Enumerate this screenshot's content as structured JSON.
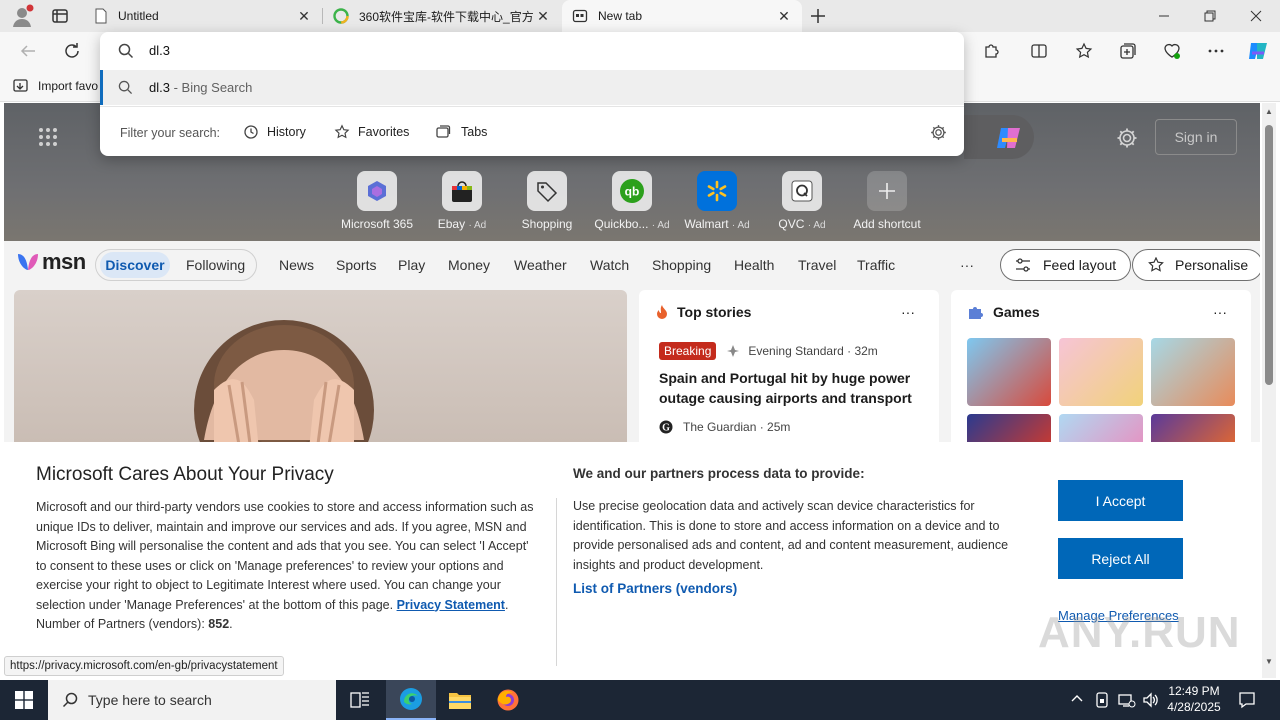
{
  "tabs": [
    {
      "title": "Untitled",
      "icon": "page-icon"
    },
    {
      "title": "360软件宝库-软件下载中心_官方",
      "icon": "360-icon"
    },
    {
      "title": "New tab",
      "icon": "newtab-icon"
    }
  ],
  "address": {
    "value": "dl.3"
  },
  "suggestion": {
    "text": "dl.3",
    "suffix": " - Bing Search"
  },
  "filter": {
    "label": "Filter your search:",
    "history": "History",
    "favorites": "Favorites",
    "tabs": "Tabs"
  },
  "favbar": {
    "import": "Import favo"
  },
  "shortcuts": [
    {
      "label": "Microsoft 365",
      "ad": ""
    },
    {
      "label": "Ebay",
      "ad": "· Ad"
    },
    {
      "label": "Shopping",
      "ad": ""
    },
    {
      "label": "Quickbo...",
      "ad": "· Ad"
    },
    {
      "label": "Walmart",
      "ad": "· Ad"
    },
    {
      "label": "QVC",
      "ad": "· Ad"
    },
    {
      "label": "Add shortcut",
      "ad": ""
    }
  ],
  "signin": "Sign in",
  "msn": {
    "logo": "msn",
    "discover": "Discover",
    "following": "Following",
    "nav": [
      "News",
      "Sports",
      "Play",
      "Money",
      "Weather",
      "Watch",
      "Shopping",
      "Health",
      "Travel",
      "Traffic"
    ],
    "more": "···",
    "feed_layout": "Feed layout",
    "personalise": "Personalise"
  },
  "topstories": {
    "title": "Top stories",
    "more": "···",
    "badge": "Breaking",
    "source1": "Evening Standard · 32m",
    "headline": "Spain and Portugal hit by huge power outage causing airports and transport t...",
    "source2": "The Guardian · 25m"
  },
  "games": {
    "title": "Games",
    "more": "···"
  },
  "consent": {
    "title": "Microsoft Cares About Your Privacy",
    "body": "Microsoft and our third-party vendors use cookies to store and access information such as unique IDs to deliver, maintain and improve our services and ads. If you agree, MSN and Microsoft Bing will personalise the content and ads that you see. You can select 'I Accept' to consent to these uses or click on 'Manage preferences' to review your options and exercise your right to object to Legitimate Interest where used.  You can change your selection under 'Manage Preferences' at the bottom of this page.",
    "privacy_link": "Privacy Statement",
    "partners_label": "Number of Partners (vendors):",
    "partners_count": "852",
    "right_title": "We and our partners process data to provide:",
    "right_body": "Use precise geolocation data and actively scan device characteristics for identification. This is done to store and access information on a device and to provide personalised ads and content, ad and content measurement, audience insights and product development.",
    "list_partners": "List of Partners (vendors)",
    "accept": "I Accept",
    "reject": "Reject All",
    "manage": "Manage Preferences"
  },
  "status_url": "https://privacy.microsoft.com/en-gb/privacystatement",
  "taskbar": {
    "search_placeholder": "Type here to search",
    "time": "12:49 PM",
    "date": "4/28/2025"
  },
  "watermark": "ANY.RUN"
}
